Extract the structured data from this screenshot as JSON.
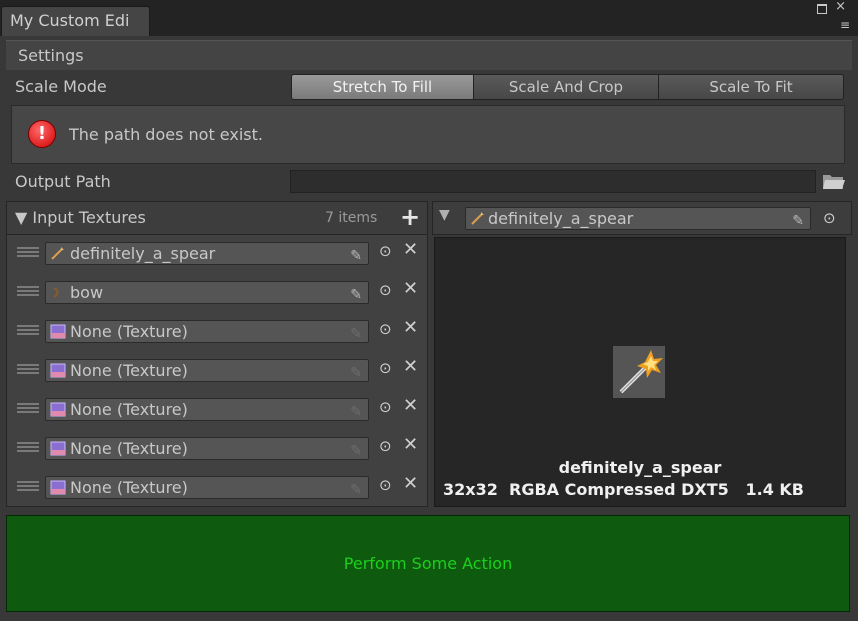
{
  "window": {
    "tab_title": "My Custom Edi",
    "close_glyph": "×",
    "menu_glyph": "≡"
  },
  "settings": {
    "header": "Settings",
    "scale_mode_label": "Scale Mode",
    "scale_modes": [
      "Stretch To Fill",
      "Scale And Crop",
      "Scale To Fit"
    ],
    "scale_mode_selected": "Stretch To Fill",
    "error_message": "The path does not exist.",
    "output_path_label": "Output Path",
    "output_path_value": ""
  },
  "input_textures": {
    "header": "Input Textures",
    "count_text": "7 items",
    "add_glyph": "+",
    "items": [
      {
        "label": "definitely_a_spear",
        "icon": "spear-sprite-icon"
      },
      {
        "label": "bow",
        "icon": "bow-sprite-icon"
      },
      {
        "label": "None (Texture)",
        "icon": "texture-icon"
      },
      {
        "label": "None (Texture)",
        "icon": "texture-icon"
      },
      {
        "label": "None (Texture)",
        "icon": "texture-icon"
      },
      {
        "label": "None (Texture)",
        "icon": "texture-icon"
      },
      {
        "label": "None (Texture)",
        "icon": "texture-icon"
      }
    ]
  },
  "preview": {
    "field_label": "definitely_a_spear",
    "name": "definitely_a_spear",
    "info": "32x32  RGBA Compressed DXT5   1.4 KB"
  },
  "action_button": "Perform Some Action",
  "colors": {
    "window_bg": "#383838",
    "accent_green": "#1ecf1e",
    "button_green": "#0e5a0e",
    "error_red": "#d00000"
  }
}
